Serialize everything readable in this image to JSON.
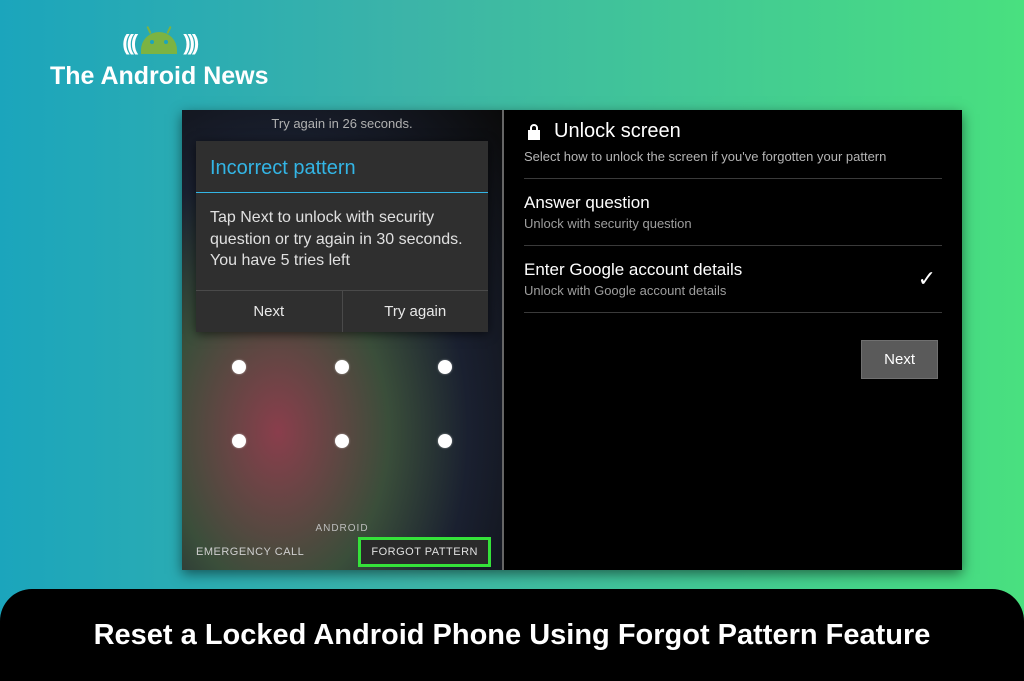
{
  "brand": {
    "name": "The Android News"
  },
  "leftPhone": {
    "retryMessage": "Try again in 26 seconds.",
    "dialog": {
      "title": "Incorrect pattern",
      "body": "Tap Next to unlock with security question or try again in 30 seconds. You have 5 tries left",
      "nextLabel": "Next",
      "tryAgainLabel": "Try again"
    },
    "carrier": "ANDROID",
    "emergencyLabel": "EMERGENCY CALL",
    "forgotLabel": "FORGOT PATTERN"
  },
  "rightPhone": {
    "title": "Unlock screen",
    "subtitle": "Select how to unlock the screen if you've forgotten your pattern",
    "options": [
      {
        "title": "Answer question",
        "sub": "Unlock with security question",
        "selected": false
      },
      {
        "title": "Enter Google account details",
        "sub": "Unlock with Google account details",
        "selected": true
      }
    ],
    "nextLabel": "Next"
  },
  "caption": "Reset a Locked Android Phone Using Forgot Pattern Feature"
}
